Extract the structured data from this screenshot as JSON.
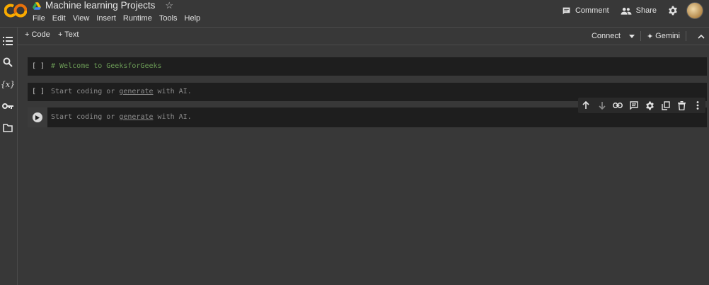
{
  "header": {
    "logo_text": "CO",
    "title": "Machine learning Projects",
    "menu": [
      "File",
      "Edit",
      "View",
      "Insert",
      "Runtime",
      "Tools",
      "Help"
    ],
    "comment_label": "Comment",
    "share_label": "Share"
  },
  "sidebar": {
    "icons": [
      "table-of-contents-icon",
      "search-icon",
      "variables-icon",
      "secrets-key-icon",
      "files-folder-icon"
    ]
  },
  "toolbar": {
    "add_code_label": "+ Code",
    "add_text_label": "+ Text",
    "connect_label": "Connect",
    "gemini_label": "Gemini"
  },
  "cells": [
    {
      "type": "code",
      "bracket": "[ ]",
      "text": "# Welcome to GeeksforGeeks"
    },
    {
      "type": "code",
      "bracket": "[ ]",
      "placeholder_pre": "Start coding or",
      "placeholder_link": "generate",
      "placeholder_post": "with AI."
    },
    {
      "type": "code",
      "active": true,
      "placeholder_pre": "Start coding or",
      "placeholder_link": "generate",
      "placeholder_post": "with AI."
    }
  ],
  "cell_toolbar": {
    "icons": [
      "move-up-icon",
      "move-down-icon",
      "link-icon",
      "comment-icon",
      "settings-icon",
      "mirror-cell-icon",
      "delete-icon",
      "more-icon"
    ]
  },
  "colors": {
    "background": "#383838",
    "cell_background": "#1e1e1e",
    "comment_green": "#6a9955",
    "logo_orange": "#f9ab00"
  }
}
